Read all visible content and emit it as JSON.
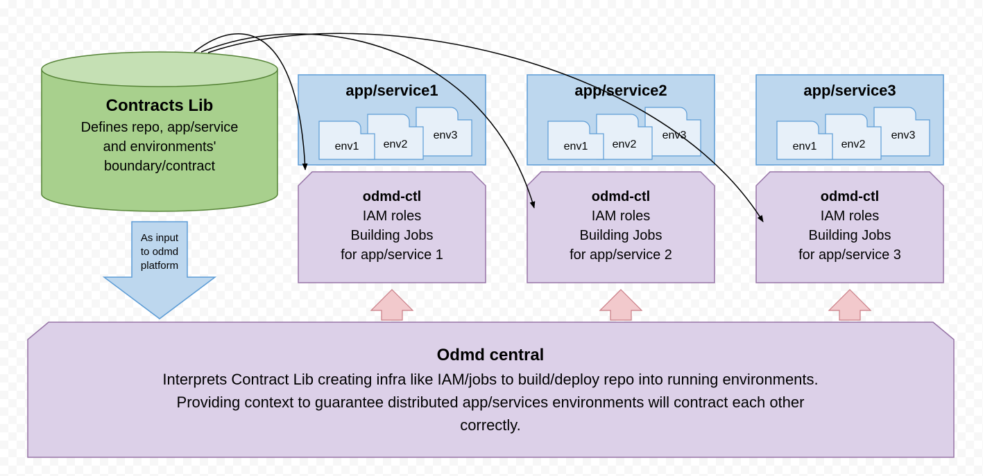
{
  "contracts": {
    "title": "Contracts Lib",
    "line1": "Defines repo, app/service",
    "line2": "and environments'",
    "line3": "boundary/contract"
  },
  "input_arrow": {
    "line1": "As input",
    "line2": "to odmd",
    "line3": "platform"
  },
  "services": [
    {
      "title": "app/service1",
      "envs": [
        "env1",
        "env2",
        "env3"
      ],
      "ctl_title": "odmd-ctl",
      "ctl_line1": "IAM roles",
      "ctl_line2": "Building Jobs",
      "ctl_line3": "for app/service 1"
    },
    {
      "title": "app/service2",
      "envs": [
        "env1",
        "env2",
        "env3"
      ],
      "ctl_title": "odmd-ctl",
      "ctl_line1": "IAM roles",
      "ctl_line2": "Building Jobs",
      "ctl_line3": "for app/service 2"
    },
    {
      "title": "app/service3",
      "envs": [
        "env1",
        "env2",
        "env3"
      ],
      "ctl_title": "odmd-ctl",
      "ctl_line1": "IAM roles",
      "ctl_line2": "Building Jobs",
      "ctl_line3": "for app/service 3"
    }
  ],
  "central": {
    "title": "Odmd central",
    "line1": "Interprets Contract Lib creating infra like IAM/jobs to build/deploy repo into running environments.",
    "line2": "Providing context to guarantee distributed app/services environments  will contract each other",
    "line3": "correctly."
  }
}
